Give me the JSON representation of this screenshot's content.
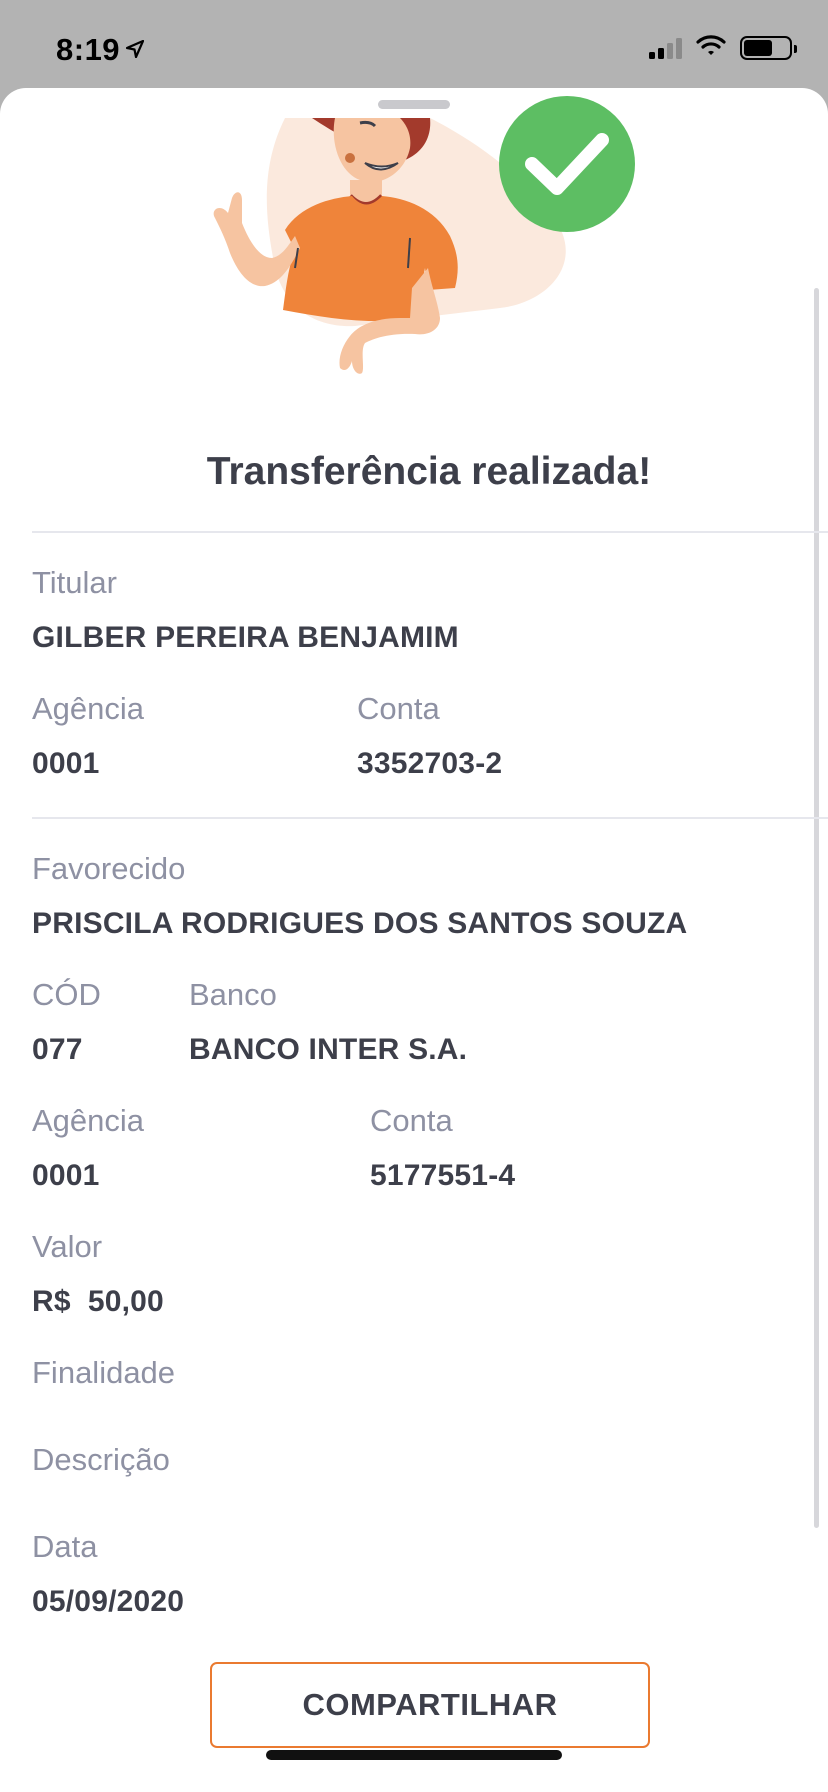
{
  "status_bar": {
    "time": "8:19"
  },
  "header": {
    "title": "Transferência realizada!"
  },
  "titular": {
    "label": "Titular",
    "name": "GILBER PEREIRA BENJAMIM",
    "agencia_label": "Agência",
    "agencia": "0001",
    "conta_label": "Conta",
    "conta": "3352703-2"
  },
  "favorecido": {
    "label": "Favorecido",
    "name": "PRISCILA RODRIGUES DOS SANTOS SOUZA",
    "cod_label": "CÓD",
    "cod": "077",
    "banco_label": "Banco",
    "banco": "BANCO INTER S.A.",
    "agencia_label": "Agência",
    "agencia": "0001",
    "conta_label": "Conta",
    "conta": "5177551-4"
  },
  "valor": {
    "label": "Valor",
    "value": "R$  50,00"
  },
  "finalidade": {
    "label": "Finalidade"
  },
  "descricao": {
    "label": "Descrição"
  },
  "data": {
    "label": "Data",
    "value": "05/09/2020"
  },
  "actions": {
    "share_label": "COMPARTILHAR"
  },
  "colors": {
    "accent": "#EA7A30",
    "success": "#5DBE63",
    "text": "#3D3F4A",
    "label": "#8E91A3"
  }
}
